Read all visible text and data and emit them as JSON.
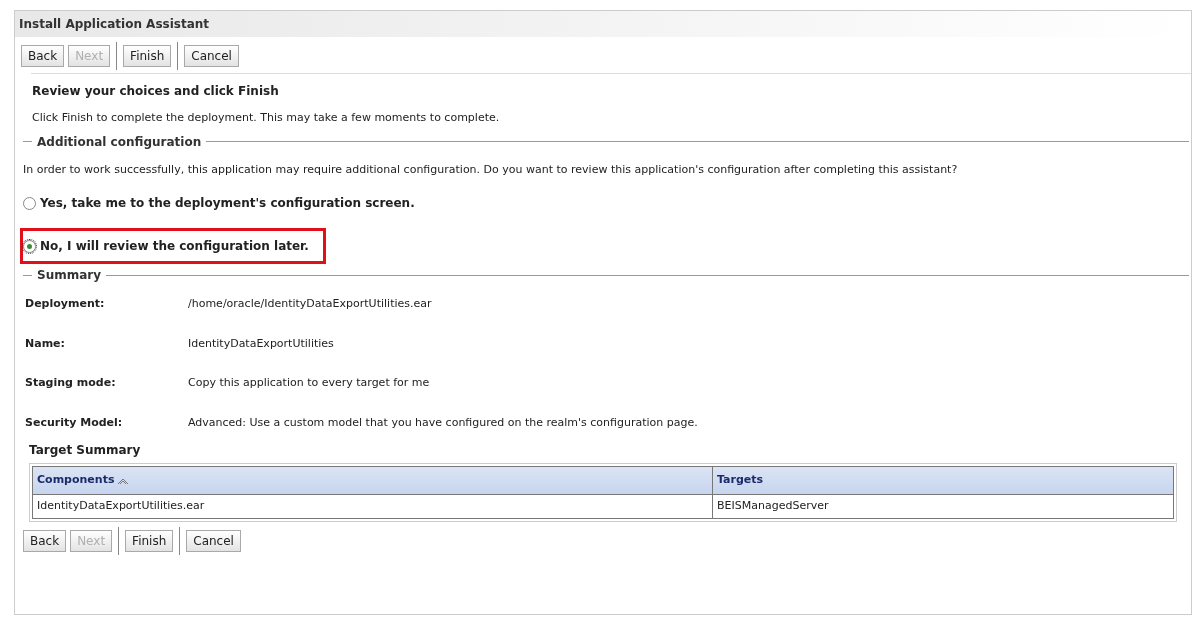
{
  "window": {
    "title": "Install Application Assistant"
  },
  "top_buttons": [
    {
      "label": "Back",
      "disabled": false
    },
    {
      "label": "Next",
      "disabled": true
    },
    {
      "label": "Finish",
      "disabled": false
    },
    {
      "label": "Cancel",
      "disabled": false
    }
  ],
  "heading": "Review your choices and click Finish",
  "intro": "Click Finish to complete the deployment. This may take a few moments to complete.",
  "additional": {
    "title": "Additional configuration",
    "question": "In order to work successfully, this application may require additional configuration. Do you want to review this application's configuration after completing this assistant?",
    "options": [
      {
        "label": "Yes, take me to the deployment's configuration screen.",
        "selected": false,
        "highlighted": false
      },
      {
        "label": "No, I will review the configuration later.",
        "selected": true,
        "highlighted": true
      }
    ]
  },
  "summary": {
    "title": "Summary",
    "rows": [
      {
        "label": "Deployment:",
        "value": "/home/oracle/IdentityDataExportUtilities.ear"
      },
      {
        "label": "Name:",
        "value": "IdentityDataExportUtilities"
      },
      {
        "label": "Staging mode:",
        "value": "Copy this application to every target for me"
      },
      {
        "label": "Security Model:",
        "value": "Advanced: Use a custom model that you have configured on the realm's configuration page."
      }
    ]
  },
  "target_summary": {
    "title": "Target Summary",
    "columns": [
      {
        "label": "Components",
        "sorted": true
      },
      {
        "label": "Targets",
        "sorted": false
      }
    ],
    "rows": [
      [
        "IdentityDataExportUtilities.ear",
        "BEISManagedServer"
      ]
    ]
  },
  "bottom_buttons": [
    {
      "label": "Back",
      "disabled": false
    },
    {
      "label": "Next",
      "disabled": true
    },
    {
      "label": "Finish",
      "disabled": false
    },
    {
      "label": "Cancel",
      "disabled": false
    }
  ]
}
